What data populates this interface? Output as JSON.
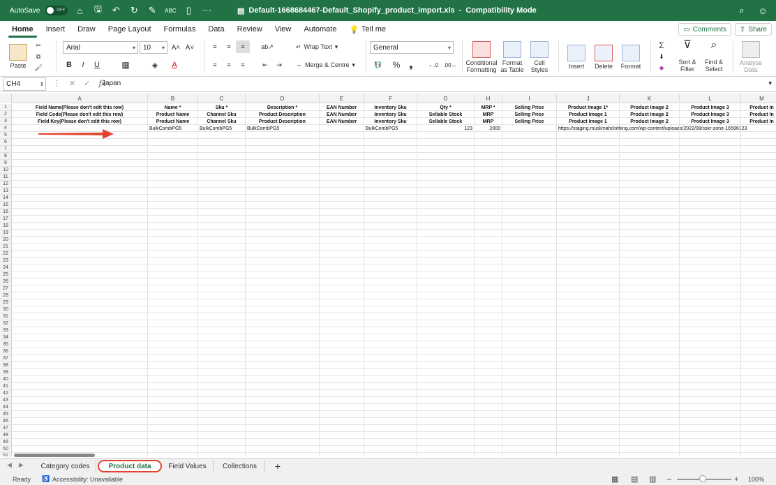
{
  "titlebar": {
    "autosave_label": "AutoSave",
    "toggle_text": "OFF",
    "doc_title": "Default-1668684467-Default_Shopify_product_import.xls",
    "mode": "Compatibility Mode",
    "separator": "-"
  },
  "tabs": [
    "Home",
    "Insert",
    "Draw",
    "Page Layout",
    "Formulas",
    "Data",
    "Review",
    "View",
    "Automate",
    "Tell me"
  ],
  "buttons": {
    "comments": "Comments",
    "share": "Share"
  },
  "ribbon": {
    "paste": "Paste",
    "font_name": "Arial",
    "font_size": "10",
    "wrap_text": "Wrap Text",
    "merge_centre": "Merge & Centre",
    "number_format": "General",
    "conditional_formatting": "Conditional Formatting",
    "format_as_table": "Format as Table",
    "cell_styles": "Cell Styles",
    "insert": "Insert",
    "delete": "Delete",
    "format": "Format",
    "sort_filter": "Sort & Filter",
    "find_select": "Find & Select",
    "analyse_data": "Analyse Data"
  },
  "formula_bar": {
    "name_box": "CH4",
    "fx": "fx",
    "content": "Japan"
  },
  "columns": [
    "A",
    "B",
    "C",
    "D",
    "E",
    "F",
    "G",
    "H",
    "I",
    "J",
    "K",
    "L",
    "M"
  ],
  "sheet_rows": [
    [
      "Field Name(Please don't edit this row)",
      "Name *",
      "Sku *",
      "Description *",
      "EAN Number",
      "Inventory Sku",
      "Qty *",
      "MRP *",
      "Selling Price",
      "Product Image 1*",
      "Product Image 2",
      "Product Image 3",
      "Product In"
    ],
    [
      "Field Code(Please don't edit this row)",
      "Product Name",
      "Channel Sku",
      "Product Description",
      "EAN Number",
      "Inventory Sku",
      "Sellable Stock",
      "MRP",
      "Selling Price",
      "Product Image 1",
      "Product Image 2",
      "Product Image 3",
      "Product In"
    ],
    [
      "Field Key(Please don't edit this row)",
      "Product Name",
      "Channel Sku",
      "Product Description",
      "EAN Number",
      "Inventory Sku",
      "Sellable Stock",
      "MRP",
      "Selling Price",
      "Product Image 1",
      "Product Image 2",
      "Product Image 3",
      "Product In"
    ],
    [
      "",
      "BulkCombPG5",
      "BulkCombPG5",
      "BulkCombPG5",
      "",
      "BulkCombPG5",
      "123",
      "2000",
      "",
      "https://staging.muslimahclothing.com/wp-content/uploads/2022/08/sskr-zone-16596123",
      "",
      "",
      ""
    ]
  ],
  "row_numbers": [
    "1",
    "2",
    "3",
    "4",
    "5",
    "6",
    "7",
    "8",
    "9",
    "10",
    "11",
    "12",
    "13",
    "14",
    "15",
    "16",
    "17",
    "18",
    "19",
    "20",
    "21",
    "22",
    "23",
    "24",
    "25",
    "26",
    "27",
    "28",
    "29",
    "30",
    "31",
    "32",
    "33",
    "34",
    "35",
    "36",
    "37",
    "38",
    "39",
    "40",
    "41",
    "42",
    "43",
    "44",
    "45",
    "46",
    "47",
    "48",
    "49",
    "50",
    "51"
  ],
  "sheets": [
    "Category codes",
    "Product data",
    "Field Values",
    "Collections"
  ],
  "active_sheet": "Product data",
  "add_sheet": "+",
  "status": {
    "ready": "Ready",
    "accessibility": "Accessibility: Unavailable",
    "zoom": "100%",
    "zoom_minus": "–",
    "zoom_plus": "+"
  },
  "colors": {
    "accent": "#217346",
    "annotation": "#e0452f"
  }
}
